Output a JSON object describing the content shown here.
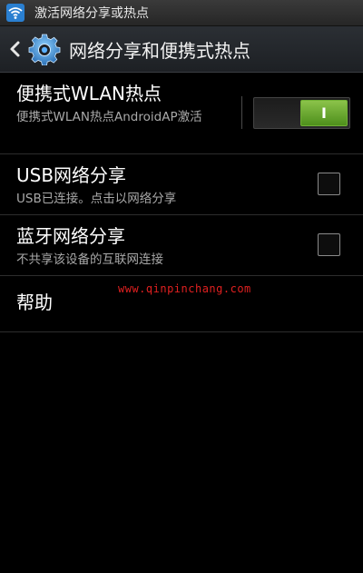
{
  "status_bar": {
    "notification_text": "激活网络分享或热点",
    "icon": "wifi-tethering-icon"
  },
  "action_bar": {
    "title": "网络分享和便携式热点",
    "back_icon": "back-chevron-icon",
    "app_icon": "settings-gear-icon"
  },
  "settings": [
    {
      "title": "便携式WLAN热点",
      "summary": "便携式WLAN热点AndroidAP激活",
      "control": "toggle",
      "state": "on",
      "toggle_mark": "I"
    },
    {
      "title": "USB网络分享",
      "summary": "USB已连接。点击以网络分享",
      "control": "checkbox",
      "checked": false
    },
    {
      "title": "蓝牙网络分享",
      "summary": "不共享该设备的互联网连接",
      "control": "checkbox",
      "checked": false
    },
    {
      "title": "帮助"
    }
  ],
  "watermark": "www.qinpinchang.com",
  "colors": {
    "background": "#000000",
    "toggle_on": "#6fb033",
    "watermark": "#e02020",
    "secondary_text": "#a9a9a9"
  }
}
